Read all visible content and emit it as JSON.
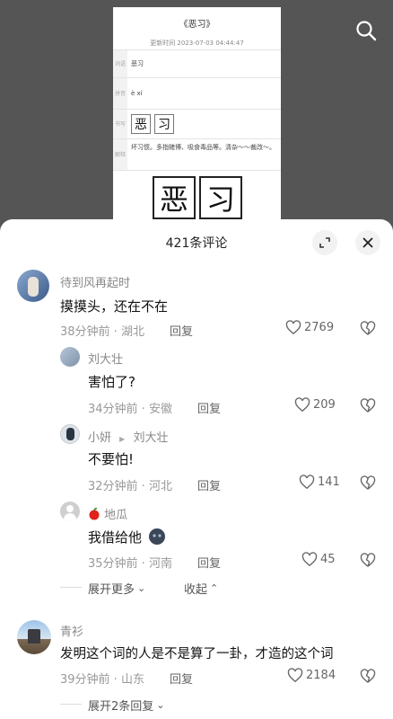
{
  "doc": {
    "title": "《恶习》",
    "time": "更新时间 2023-07-03 04:44:47",
    "rows": [
      {
        "key": "词语",
        "value": "恶习"
      },
      {
        "key": "拼音",
        "value": "è xí"
      },
      {
        "key": "书写",
        "chars": [
          "恶",
          "习"
        ]
      },
      {
        "key": "解释",
        "value": "坏习惯。多指赌博、吸食毒品等。清杂～～裁改～。"
      }
    ],
    "big_chars": [
      "恶",
      "习"
    ]
  },
  "header": {
    "title": "421条评论"
  },
  "comments": [
    {
      "user": "待到风再起时",
      "text": "摸摸头，还在不在",
      "meta": "38分钟前 · 湖北",
      "reply": "回复",
      "likes": "2769"
    },
    {
      "user": "刘大壮",
      "text": "害怕了?",
      "meta": "34分钟前 · 安徽",
      "reply": "回复",
      "likes": "209"
    },
    {
      "user": "小妍",
      "reply_to": "刘大壮",
      "text": "不要怕!",
      "meta": "32分钟前 · 河北",
      "reply": "回复",
      "likes": "141"
    },
    {
      "user": "地瓜",
      "text": "我借给他",
      "meta": "35分钟前 · 河南",
      "reply": "回复",
      "likes": "45"
    },
    {
      "user": "青衫",
      "text": "发明这个词的人是不是算了一卦，才造的这个词",
      "meta": "39分钟前 · 山东",
      "reply": "回复",
      "likes": "2184"
    }
  ],
  "expand_more": "展开更多",
  "collapse": "收起",
  "expand_replies": "展开2条回复"
}
